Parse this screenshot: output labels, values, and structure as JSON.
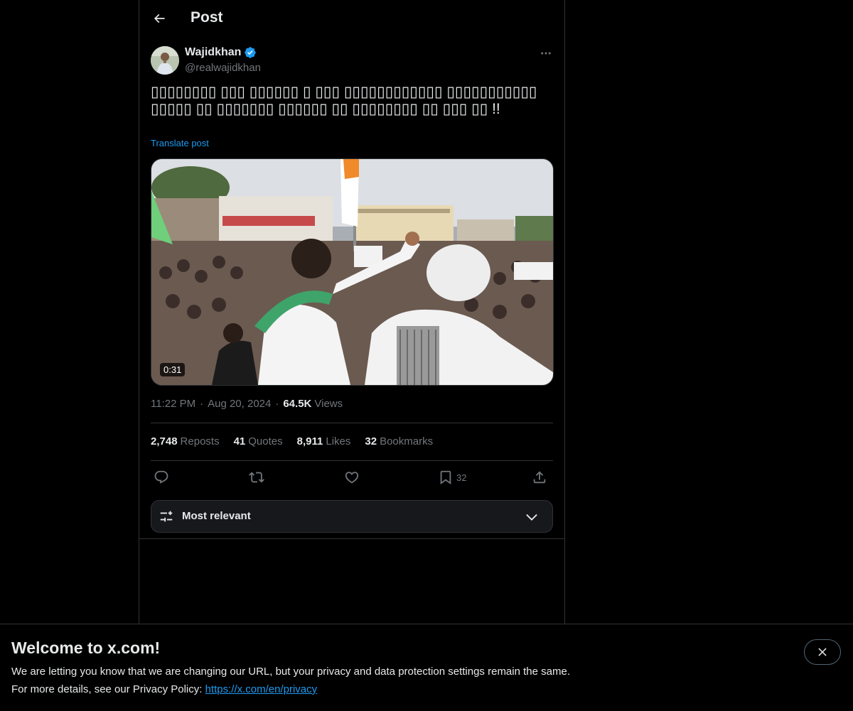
{
  "header": {
    "title": "Post",
    "back_icon": "arrow-left-icon"
  },
  "post": {
    "author": {
      "name": "Wajidkhan",
      "handle": "@realwajidkhan",
      "verified": true,
      "verified_color": "#1d9bf0"
    },
    "text": "▯▯▯▯▯▯▯▯ ▯▯▯ ▯▯▯▯▯▯ ▯ ▯▯▯ ▯▯▯▯▯▯▯▯▯▯▯▯ ▯▯▯▯▯▯▯▯▯▯▯ ▯▯▯▯▯ ▯▯ ▯▯▯▯▯▯▯ ▯▯▯▯▯▯ ▯▯ ▯▯▯▯▯▯▯▯ ▯▯ ▯▯▯ ▯▯ !!",
    "translate_label": "Translate post",
    "video_duration": "0:31",
    "time": "11:22 PM",
    "date": "Aug 20, 2024",
    "views_count": "64.5K",
    "views_label": "Views",
    "stats": {
      "reposts": {
        "count": "2,748",
        "label": "Reposts"
      },
      "quotes": {
        "count": "41",
        "label": "Quotes"
      },
      "likes": {
        "count": "8,911",
        "label": "Likes"
      },
      "bookmarks": {
        "count": "32",
        "label": "Bookmarks"
      }
    },
    "actions": {
      "reply_icon": "reply-icon",
      "repost_icon": "repost-icon",
      "like_icon": "heart-icon",
      "bookmark_icon": "bookmark-icon",
      "bookmark_count": "32",
      "share_icon": "share-icon"
    }
  },
  "sort": {
    "label": "Most relevant"
  },
  "banner": {
    "title": "Welcome to x.com!",
    "line1": "We are letting you know that we are changing our URL, but your privacy and data protection settings remain the same.",
    "line2_prefix": "For more details, see our Privacy Policy: ",
    "link": "https://x.com/en/privacy"
  },
  "colors": {
    "background": "#000000",
    "text": "#e7e9ea",
    "muted": "#71767b",
    "accent": "#1d9bf0",
    "border": "#2f3336"
  }
}
